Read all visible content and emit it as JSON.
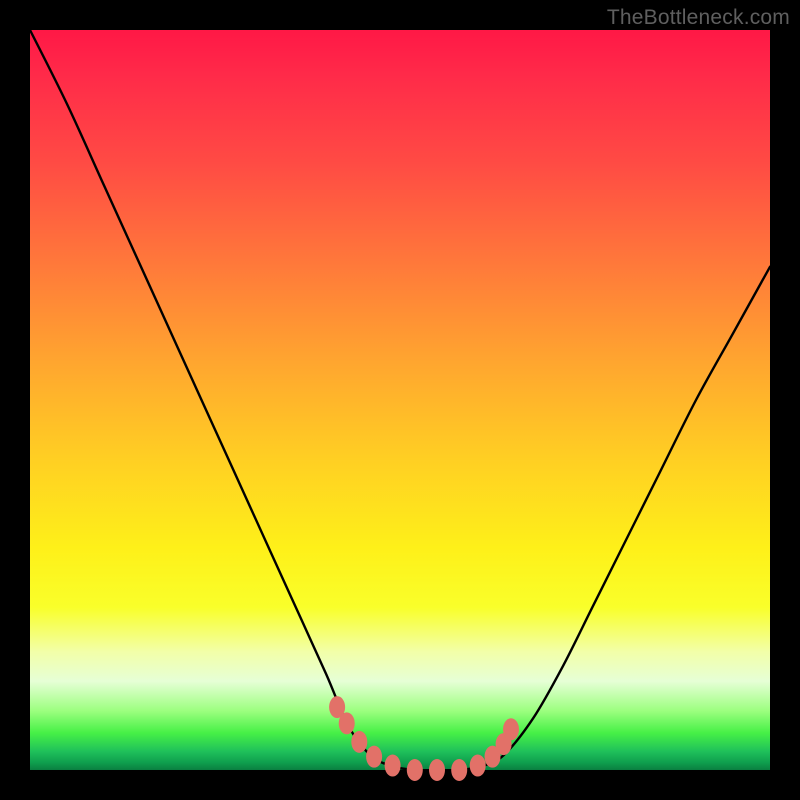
{
  "watermark": "TheBottleneck.com",
  "chart_data": {
    "type": "line",
    "title": "",
    "xlabel": "",
    "ylabel": "",
    "xlim": [
      0,
      100
    ],
    "ylim": [
      0,
      100
    ],
    "series": [
      {
        "name": "bottleneck-curve",
        "x": [
          0,
          5,
          10,
          15,
          20,
          25,
          30,
          35,
          40,
          43,
          46,
          49,
          52,
          55,
          58,
          61,
          64,
          68,
          72,
          76,
          80,
          85,
          90,
          95,
          100
        ],
        "values": [
          100,
          90,
          79,
          68,
          57,
          46,
          35,
          24,
          13,
          6,
          2,
          0.5,
          0,
          0,
          0,
          0.5,
          2,
          7,
          14,
          22,
          30,
          40,
          50,
          59,
          68
        ]
      }
    ],
    "markers": {
      "name": "curve-dots",
      "x": [
        41.5,
        42.8,
        44.5,
        46.5,
        49,
        52,
        55,
        58,
        60.5,
        62.5,
        64,
        65
      ],
      "values": [
        8.5,
        6.3,
        3.8,
        1.8,
        0.6,
        0,
        0,
        0,
        0.6,
        1.8,
        3.5,
        5.5
      ]
    },
    "colors": {
      "curve": "#000000",
      "markers": "#e27168",
      "gradient_top": "#ff1846",
      "gradient_mid": "#fef019",
      "gradient_bottom": "#0a7f40"
    }
  }
}
